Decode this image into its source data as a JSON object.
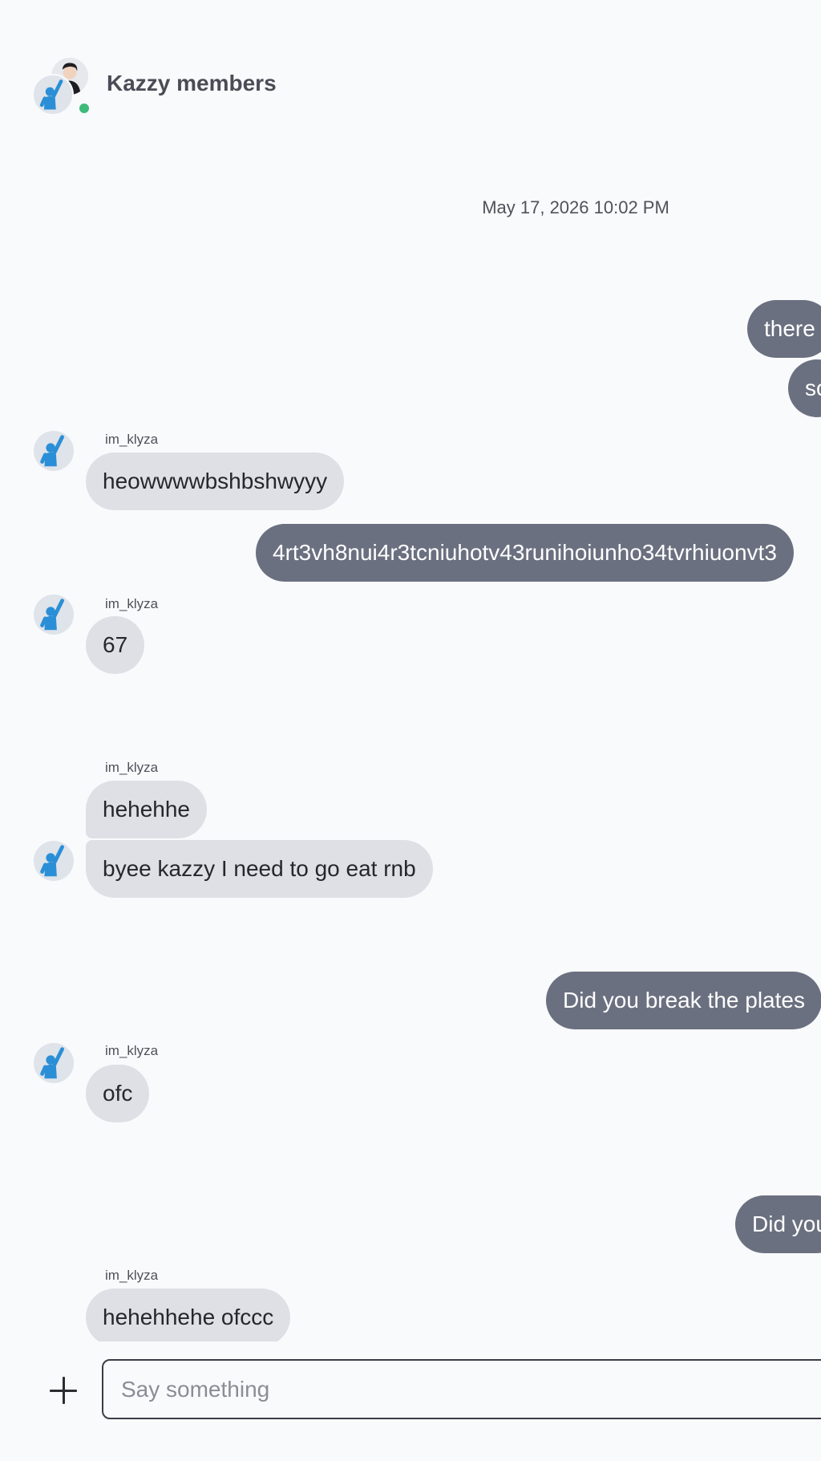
{
  "header": {
    "title": "Kazzy members",
    "online_status": "online",
    "status_color": "#3dbb78"
  },
  "timestamp": "May 17, 2026 10:02 PM",
  "messages": [
    {
      "direction": "out",
      "text": "there"
    },
    {
      "direction": "out",
      "text": "so"
    },
    {
      "direction": "in",
      "sender": "im_klyza",
      "text": "heowwwwbshbshwyyy"
    },
    {
      "direction": "out",
      "text": "4rt3vh8nui4r3tcniuhotv43runihoiunho34tvrhiuonvt3"
    },
    {
      "direction": "in",
      "sender": "im_klyza",
      "text": "67"
    },
    {
      "direction": "in",
      "sender": "im_klyza",
      "text": "hehehhe"
    },
    {
      "direction": "in",
      "text": "byee kazzy I need to go eat rnb"
    },
    {
      "direction": "out",
      "text": "Did you break the plates"
    },
    {
      "direction": "in",
      "sender": "im_klyza",
      "text": "ofc"
    },
    {
      "direction": "out",
      "text": "Did you"
    },
    {
      "direction": "in",
      "sender": "im_klyza",
      "text": "hehehhehe ofccc"
    }
  ],
  "composer": {
    "placeholder": "Say something",
    "value": "",
    "add_icon": "plus-icon"
  },
  "colors": {
    "incoming_bubble": "#dfe0e5",
    "outgoing_bubble": "#6b7080",
    "avatar_figure": "#2a8fd6"
  }
}
